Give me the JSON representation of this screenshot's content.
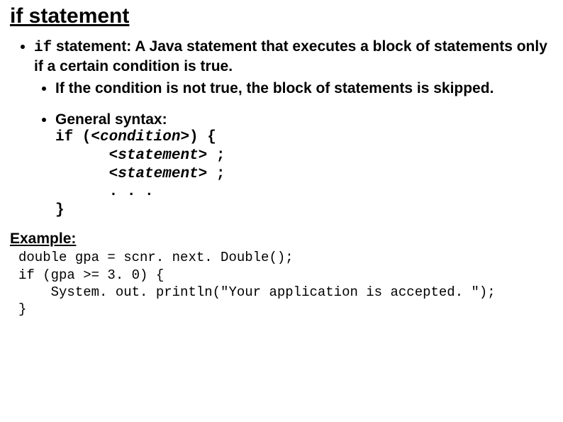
{
  "title": "if statement",
  "bullet1": {
    "code_kw": "if",
    "rest": " statement: A Java statement that executes a block of statements only if a certain condition is true."
  },
  "sub1": "If the condition is not true, the block of statements is skipped.",
  "sub2": {
    "lead": "General syntax:",
    "l1a": "if (",
    "l1cond": "<condition>",
    "l1b": ") {",
    "l2pad": "      ",
    "l2stmt": "<statement>",
    "l2semi": " ;",
    "l3pad": "      ",
    "l3stmt": "<statement>",
    "l3semi": " ;",
    "l4": "      . . .",
    "l5": "}"
  },
  "example_head": "Example:",
  "example_code": "double gpa = scnr. next. Double();\nif (gpa >= 3. 0) {\n    System. out. println(\"Your application is accepted. \");\n}"
}
